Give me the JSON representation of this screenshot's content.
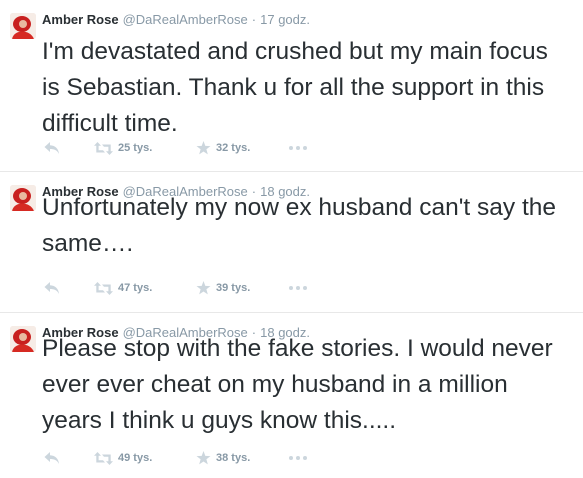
{
  "tweets": [
    {
      "name": "Amber Rose",
      "handle": "@DaRealAmberRose",
      "separator": "·",
      "time": "17 godz.",
      "text": "I'm devastated and crushed but my main focus is Sebastian. Thank u for all the support in this difficult time.",
      "retweets": "25 tys.",
      "favorites": "32 tys."
    },
    {
      "name": "Amber Rose",
      "handle": "@DaRealAmberRose",
      "separator": "·",
      "time": "18 godz.",
      "text": "Unfortunately my now ex husband can't say the same….",
      "retweets": "47 tys.",
      "favorites": "39 tys."
    },
    {
      "name": "Amber Rose",
      "handle": "@DaRealAmberRose",
      "separator": "·",
      "time": "18 godz.",
      "text": "Please stop with the fake stories. I would never ever ever cheat on my husband in a million years I think u guys know this.....",
      "retweets": "49 tys.",
      "favorites": "38 tys."
    }
  ],
  "icons": {
    "reply": "reply-icon",
    "retweet": "retweet-icon",
    "favorite": "star-icon",
    "more": "more-icon"
  },
  "colors": {
    "text": "#292f33",
    "muted": "#8899a6",
    "icon": "#ccd6dd",
    "divider": "#e8e8e8"
  }
}
